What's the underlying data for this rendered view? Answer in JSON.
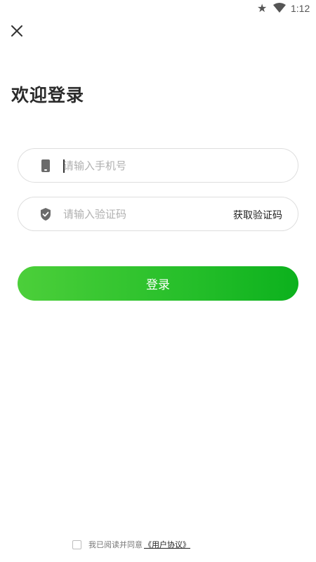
{
  "status_bar": {
    "time": "1:12",
    "icons": [
      "star-icon",
      "wifi-icon"
    ]
  },
  "header": {
    "close_icon": "close-icon"
  },
  "title": "欢迎登录",
  "phone_field": {
    "placeholder": "请输入手机号",
    "value": "",
    "icon": "phone-icon"
  },
  "code_field": {
    "placeholder": "请输入验证码",
    "value": "",
    "icon": "shield-check-icon",
    "get_code_label": "获取验证码"
  },
  "login_button": {
    "label": "登录",
    "colors": [
      "#4ccf3a",
      "#0cb11d"
    ]
  },
  "agreement": {
    "checked": false,
    "text": "我已阅读并同意",
    "link_text": "《用户协议》"
  }
}
